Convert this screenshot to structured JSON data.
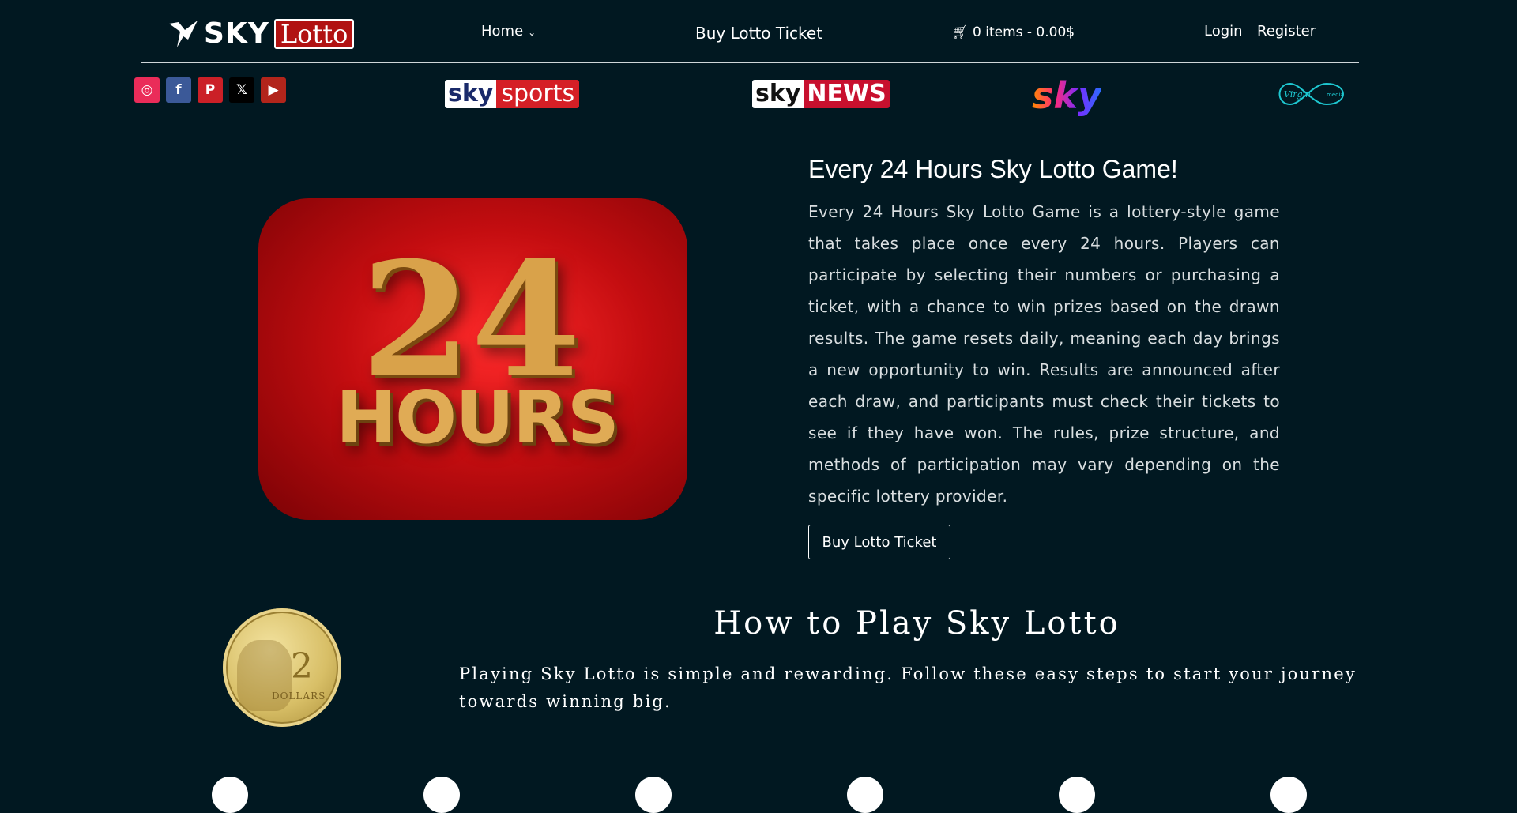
{
  "header": {
    "logo_sky": "SKY",
    "logo_lotto": "Lotto",
    "nav": {
      "home": "Home",
      "buy": "Buy Lotto Ticket",
      "cart": "0 items - 0.00$",
      "login": "Login",
      "register": "Register"
    }
  },
  "social": [
    {
      "name": "instagram",
      "glyph": "◎"
    },
    {
      "name": "facebook",
      "glyph": "f"
    },
    {
      "name": "pinterest",
      "glyph": "P"
    },
    {
      "name": "x",
      "glyph": "𝕏"
    },
    {
      "name": "youtube",
      "glyph": "▶"
    }
  ],
  "partners": {
    "sky_sports_a": "sky",
    "sky_sports_b": "sports",
    "sky_news_a": "sky",
    "sky_news_b": "NEWS",
    "sky": "sky",
    "virgin": "Virgin media"
  },
  "hero": {
    "image_line1": "24",
    "image_line2": "HOURS",
    "title": "Every 24 Hours Sky Lotto Game!",
    "text": "Every 24 Hours Sky Lotto Game is a lottery-style game that takes place once every 24 hours. Players can participate by selecting their numbers or purchasing a ticket, with a chance to win prizes based on the drawn results. The game resets daily, meaning each day brings a new opportunity to win. Results are announced after each draw, and participants must check their tickets to see if they have won. The rules, prize structure, and methods of participation may vary depending on the specific lottery provider.",
    "button": "Buy Lotto Ticket"
  },
  "coin": {
    "value": "2",
    "label": "DOLLARS"
  },
  "how": {
    "title": "How to Play Sky Lotto",
    "text": "Playing Sky Lotto is simple and rewarding. Follow these easy steps to start your journey towards winning big."
  },
  "colors": {
    "background": "#011821",
    "accent_red": "#c40d10",
    "gold": "#d9a24a"
  }
}
